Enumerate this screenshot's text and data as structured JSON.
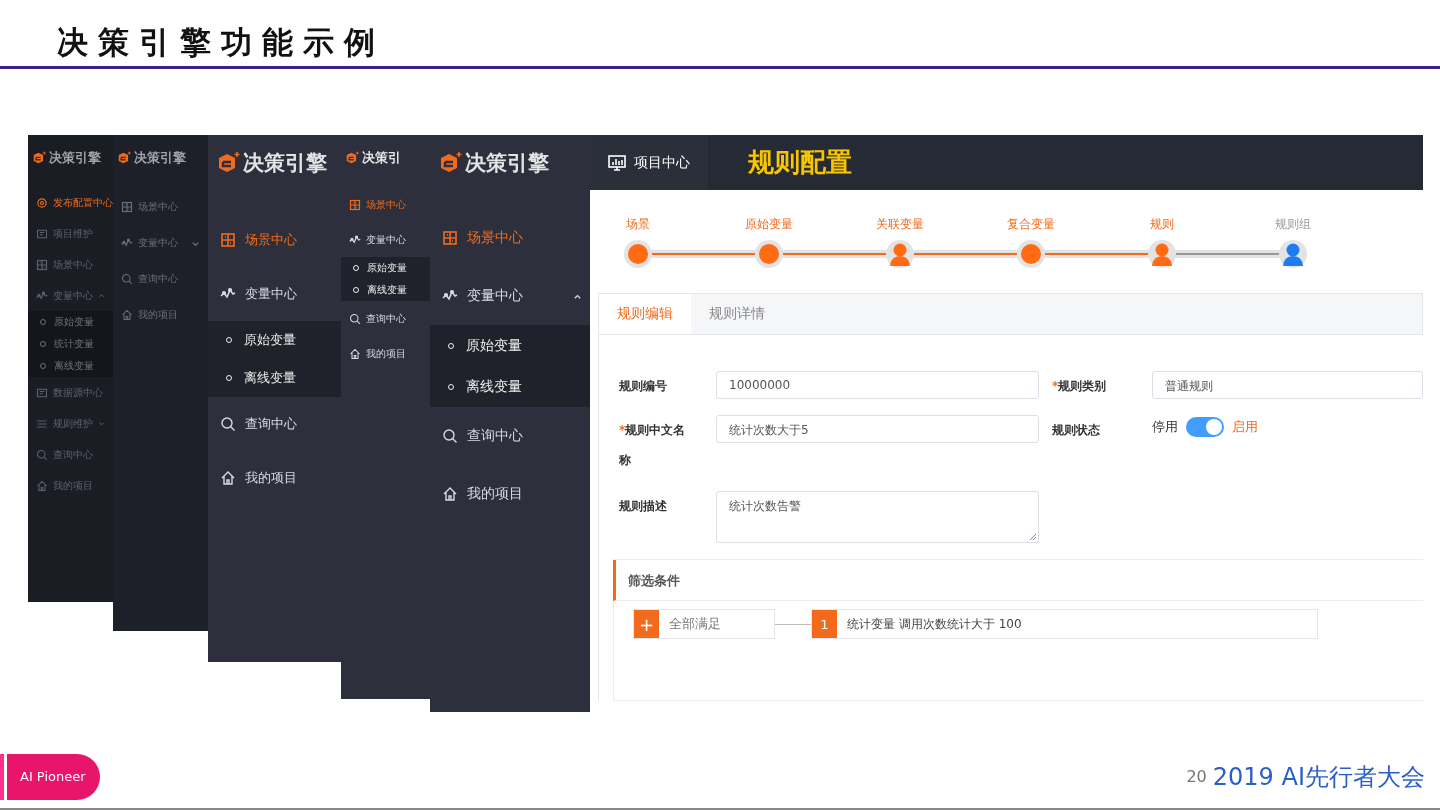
{
  "slide": {
    "title": "决策引擎功能示例",
    "footer_badge": "AI Pioneer",
    "page_number": "20",
    "footer_brand": "2019 AI先行者大会"
  },
  "back_screens": [
    {
      "logo": "决策引擎",
      "items": [
        {
          "label": "发布配置中心",
          "kind": "gear",
          "selected": true
        },
        {
          "label": "项目维护",
          "kind": "panel",
          "selected": false
        },
        {
          "label": "场景中心",
          "kind": "grid",
          "selected": false
        },
        {
          "label": "变量中心",
          "kind": "wave",
          "selected": false,
          "expanded": true,
          "children": [
            {
              "label": "原始变量",
              "selected": false
            },
            {
              "label": "统计变量",
              "selected": false
            },
            {
              "label": "离线变量",
              "selected": false
            }
          ]
        },
        {
          "label": "数据源中心",
          "kind": "panel",
          "selected": false
        },
        {
          "label": "规则维护",
          "kind": "list",
          "selected": false,
          "expanded": false
        },
        {
          "label": "查询中心",
          "kind": "search",
          "selected": false
        },
        {
          "label": "我的项目",
          "kind": "home",
          "selected": false
        }
      ]
    },
    {
      "logo": "决策引擎",
      "items": [
        {
          "label": "场景中心",
          "kind": "grid",
          "selected": false
        },
        {
          "label": "变量中心",
          "kind": "wave",
          "selected": false,
          "expanded": false
        },
        {
          "label": "查询中心",
          "kind": "search",
          "selected": false
        },
        {
          "label": "我的项目",
          "kind": "home",
          "selected": false
        }
      ]
    },
    {
      "logo": "决策引擎",
      "items": [
        {
          "label": "场景中心",
          "kind": "grid",
          "selected": true
        },
        {
          "label": "变量中心",
          "kind": "wave",
          "selected": false,
          "children": [
            {
              "label": "原始变量",
              "selected": false
            },
            {
              "label": "离线变量",
              "selected": false
            }
          ]
        },
        {
          "label": "查询中心",
          "kind": "search",
          "selected": false
        },
        {
          "label": "我的项目",
          "kind": "home",
          "selected": false
        }
      ]
    },
    {
      "logo": "决策引",
      "items": [
        {
          "label": "场景中心",
          "kind": "grid",
          "selected": true
        },
        {
          "label": "变量中心",
          "kind": "wave",
          "selected": false,
          "children": [
            {
              "label": "原始变量",
              "selected": false
            },
            {
              "label": "离线变量",
              "selected": false
            }
          ]
        },
        {
          "label": "查询中心",
          "kind": "search",
          "selected": false
        },
        {
          "label": "我的项目",
          "kind": "home",
          "selected": false
        }
      ]
    }
  ],
  "main_screen": {
    "sidebar": {
      "logo": "决策引擎",
      "items": [
        {
          "label": "场景中心",
          "kind": "grid",
          "selected": true
        },
        {
          "label": "变量中心",
          "kind": "wave",
          "selected": false,
          "expanded": true,
          "children": [
            {
              "label": "原始变量",
              "selected": false
            },
            {
              "label": "离线变量",
              "selected": false
            }
          ]
        },
        {
          "label": "查询中心",
          "kind": "search",
          "selected": false
        },
        {
          "label": "我的项目",
          "kind": "home",
          "selected": false
        }
      ]
    },
    "header": {
      "nav": "项目中心",
      "page_title": "规则配置"
    },
    "steps": [
      {
        "label": "场景",
        "kind": "dot",
        "done": true,
        "color": "#ff6a13"
      },
      {
        "label": "原始变量",
        "kind": "dot",
        "done": true,
        "color": "#ff6a13"
      },
      {
        "label": "关联变量",
        "kind": "person",
        "done": true,
        "color": "#ff6a13"
      },
      {
        "label": "复合变量",
        "kind": "dot",
        "done": true,
        "color": "#ff6a13"
      },
      {
        "label": "规则",
        "kind": "person",
        "done": true,
        "color": "#ff6a13"
      },
      {
        "label": "规则组",
        "kind": "person",
        "done": false,
        "color": "#1e7cf0"
      }
    ],
    "tabs": [
      {
        "label": "规则编辑",
        "selected": true
      },
      {
        "label": "规则详情",
        "selected": false
      }
    ],
    "form": {
      "rule_id": {
        "label": "规则编号",
        "value": "10000000"
      },
      "rule_type": {
        "label": "规则类别",
        "required_mark": "*",
        "value": "普通规则"
      },
      "rule_name": {
        "label": "规则中文名称",
        "required_mark": "*",
        "value": "统计次数大于5"
      },
      "rule_status": {
        "label": "规则状态",
        "off_label": "停用",
        "on_label": "启用",
        "on": true
      },
      "rule_desc": {
        "label": "规则描述",
        "value": "统计次数告警"
      }
    },
    "filter": {
      "title": "筛选条件",
      "add": "+",
      "group": "全部满足",
      "conditions": [
        {
          "index": "1",
          "text": "统计变量 调用次数统计大于 100"
        }
      ]
    }
  }
}
